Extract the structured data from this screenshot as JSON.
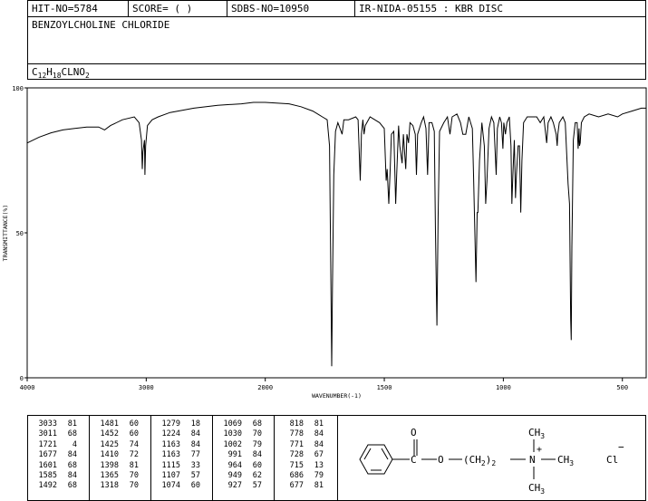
{
  "header": {
    "hit_no": "HIT-NO=5784",
    "score": "SCORE=  (   )",
    "sdbs_no": "SDBS-NO=10950",
    "method": "IR-NIDA-05155 : KBR DISC"
  },
  "compound": {
    "name": "BENZOYLCHOLINE CHLORIDE",
    "formula_c": "C",
    "formula_c_sub": "12",
    "formula_h": "H",
    "formula_h_sub": "18",
    "formula_rest": "CLNO",
    "formula_o_sub": "2"
  },
  "chart_data": {
    "type": "line",
    "xlabel": "WAVENUMBER(-1)",
    "ylabel": "TRANSMITTANCE(%)",
    "xlim": [
      4000,
      400
    ],
    "ylim": [
      0,
      100
    ],
    "x_ticks": [
      "4000",
      "3000",
      "2000",
      "1500",
      "1000",
      "500"
    ],
    "y_ticks": [
      "100",
      "50",
      "0"
    ],
    "grid": false,
    "series": [
      {
        "points": [
          [
            4000,
            81
          ],
          [
            3900,
            83
          ],
          [
            3800,
            84.5
          ],
          [
            3700,
            85.5
          ],
          [
            3600,
            86
          ],
          [
            3500,
            86.5
          ],
          [
            3400,
            86.5
          ],
          [
            3350,
            85.5
          ],
          [
            3300,
            87
          ],
          [
            3200,
            89
          ],
          [
            3100,
            90
          ],
          [
            3060,
            88
          ],
          [
            3040,
            82
          ],
          [
            3033,
            72
          ],
          [
            3028,
            78
          ],
          [
            3015,
            82
          ],
          [
            3011,
            70
          ],
          [
            3005,
            80
          ],
          [
            2990,
            87
          ],
          [
            2950,
            89
          ],
          [
            2900,
            90
          ],
          [
            2800,
            91.5
          ],
          [
            2600,
            93
          ],
          [
            2400,
            94
          ],
          [
            2200,
            94.5
          ],
          [
            2100,
            95
          ],
          [
            2000,
            95
          ],
          [
            1900,
            94.5
          ],
          [
            1850,
            93.5
          ],
          [
            1800,
            92
          ],
          [
            1760,
            90
          ],
          [
            1740,
            89
          ],
          [
            1730,
            80
          ],
          [
            1725,
            40
          ],
          [
            1721,
            4
          ],
          [
            1718,
            30
          ],
          [
            1712,
            70
          ],
          [
            1705,
            85
          ],
          [
            1695,
            88
          ],
          [
            1686,
            86
          ],
          [
            1677,
            84
          ],
          [
            1670,
            89
          ],
          [
            1650,
            89
          ],
          [
            1620,
            90
          ],
          [
            1610,
            89
          ],
          [
            1601,
            68
          ],
          [
            1596,
            84
          ],
          [
            1590,
            89
          ],
          [
            1585,
            84
          ],
          [
            1580,
            87
          ],
          [
            1560,
            90
          ],
          [
            1520,
            88
          ],
          [
            1500,
            86
          ],
          [
            1492,
            68
          ],
          [
            1488,
            72
          ],
          [
            1481,
            60
          ],
          [
            1476,
            70
          ],
          [
            1470,
            84
          ],
          [
            1460,
            85
          ],
          [
            1452,
            60
          ],
          [
            1448,
            70
          ],
          [
            1440,
            87
          ],
          [
            1435,
            80
          ],
          [
            1425,
            74
          ],
          [
            1420,
            84
          ],
          [
            1410,
            72
          ],
          [
            1405,
            84
          ],
          [
            1398,
            81
          ],
          [
            1392,
            88
          ],
          [
            1380,
            87
          ],
          [
            1370,
            84
          ],
          [
            1365,
            70
          ],
          [
            1360,
            84
          ],
          [
            1345,
            88
          ],
          [
            1335,
            90
          ],
          [
            1325,
            86
          ],
          [
            1318,
            70
          ],
          [
            1312,
            88
          ],
          [
            1300,
            88
          ],
          [
            1290,
            85
          ],
          [
            1285,
            50
          ],
          [
            1279,
            18
          ],
          [
            1274,
            55
          ],
          [
            1268,
            85
          ],
          [
            1250,
            88
          ],
          [
            1235,
            90
          ],
          [
            1224,
            84
          ],
          [
            1215,
            90
          ],
          [
            1195,
            91
          ],
          [
            1180,
            88
          ],
          [
            1170,
            84
          ],
          [
            1163,
            84
          ],
          [
            1158,
            84
          ],
          [
            1145,
            90
          ],
          [
            1130,
            86
          ],
          [
            1125,
            70
          ],
          [
            1115,
            33
          ],
          [
            1110,
            57
          ],
          [
            1107,
            57
          ],
          [
            1100,
            75
          ],
          [
            1090,
            88
          ],
          [
            1080,
            80
          ],
          [
            1074,
            60
          ],
          [
            1069,
            68
          ],
          [
            1060,
            86
          ],
          [
            1050,
            90
          ],
          [
            1040,
            88
          ],
          [
            1030,
            70
          ],
          [
            1025,
            86
          ],
          [
            1015,
            90
          ],
          [
            1008,
            88
          ],
          [
            1002,
            79
          ],
          [
            998,
            88
          ],
          [
            991,
            84
          ],
          [
            985,
            88
          ],
          [
            975,
            90
          ],
          [
            968,
            80
          ],
          [
            964,
            60
          ],
          [
            960,
            70
          ],
          [
            954,
            82
          ],
          [
            949,
            62
          ],
          [
            945,
            70
          ],
          [
            938,
            80
          ],
          [
            932,
            80
          ],
          [
            927,
            57
          ],
          [
            922,
            75
          ],
          [
            915,
            88
          ],
          [
            900,
            90
          ],
          [
            880,
            90
          ],
          [
            860,
            90
          ],
          [
            845,
            88
          ],
          [
            830,
            90
          ],
          [
            818,
            81
          ],
          [
            812,
            88
          ],
          [
            800,
            90
          ],
          [
            790,
            88
          ],
          [
            778,
            84
          ],
          [
            774,
            80
          ],
          [
            771,
            84
          ],
          [
            765,
            88
          ],
          [
            750,
            90
          ],
          [
            740,
            88
          ],
          [
            728,
            67
          ],
          [
            722,
            60
          ],
          [
            717,
            20
          ],
          [
            715,
            13
          ],
          [
            712,
            45
          ],
          [
            706,
            82
          ],
          [
            698,
            88
          ],
          [
            690,
            88
          ],
          [
            686,
            79
          ],
          [
            682,
            86
          ],
          [
            680,
            80
          ],
          [
            677,
            81
          ],
          [
            672,
            88
          ],
          [
            660,
            90
          ],
          [
            640,
            91
          ],
          [
            600,
            90
          ],
          [
            560,
            91
          ],
          [
            520,
            90
          ],
          [
            500,
            91
          ],
          [
            460,
            92
          ],
          [
            420,
            93
          ],
          [
            400,
            93
          ]
        ]
      }
    ]
  },
  "peaks": [
    [
      [
        "3033",
        "81"
      ],
      [
        "3011",
        "68"
      ],
      [
        "1721",
        "4"
      ],
      [
        "1677",
        "84"
      ],
      [
        "1601",
        "68"
      ],
      [
        "1585",
        "84"
      ],
      [
        "1492",
        "68"
      ]
    ],
    [
      [
        "1481",
        "60"
      ],
      [
        "1452",
        "60"
      ],
      [
        "1425",
        "74"
      ],
      [
        "1410",
        "72"
      ],
      [
        "1398",
        "81"
      ],
      [
        "1365",
        "70"
      ],
      [
        "1318",
        "70"
      ]
    ],
    [
      [
        "1279",
        "18"
      ],
      [
        "1224",
        "84"
      ],
      [
        "1163",
        "84"
      ],
      [
        "1163",
        "77"
      ],
      [
        "1115",
        "33"
      ],
      [
        "1107",
        "57"
      ],
      [
        "1074",
        "60"
      ]
    ],
    [
      [
        "1069",
        "68"
      ],
      [
        "1030",
        "70"
      ],
      [
        "1002",
        "79"
      ],
      [
        "991",
        "84"
      ],
      [
        "964",
        "60"
      ],
      [
        "949",
        "62"
      ],
      [
        "927",
        "57"
      ]
    ],
    [
      [
        "818",
        "81"
      ],
      [
        "778",
        "84"
      ],
      [
        "771",
        "84"
      ],
      [
        "728",
        "67"
      ],
      [
        "715",
        "13"
      ],
      [
        "686",
        "79"
      ],
      [
        "677",
        "81"
      ]
    ]
  ],
  "structure": {
    "carbonyl_c": "C",
    "carbonyl_o": "O",
    "ester_o": "O",
    "chain": "(CH",
    "chain_sub": "2",
    "chain_close": ")",
    "chain_sub2": "2",
    "n_atom": "N",
    "n_charge": "+",
    "ch3_top": "CH",
    "ch3_top_sub": "3",
    "ch3_right": "CH",
    "ch3_right_sub": "3",
    "ch3_bottom": "CH",
    "ch3_bottom_sub": "3",
    "chloride": "Cl",
    "chloride_charge": "−"
  }
}
